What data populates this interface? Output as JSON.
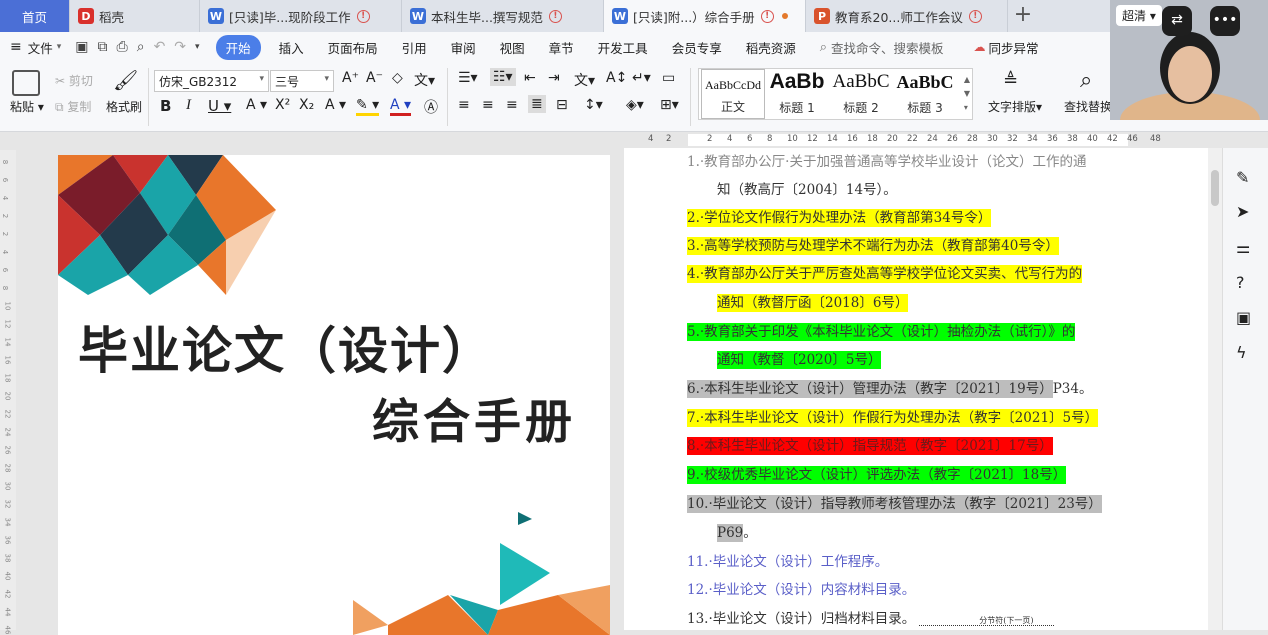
{
  "tabs": [
    {
      "label": "首页",
      "type": "home"
    },
    {
      "label": "稻壳",
      "icon": "docer-icon",
      "icon_color": "#d9302c"
    },
    {
      "label": "[只读]毕...现阶段工作",
      "icon": "word-icon",
      "icon_color": "#3b6fd6",
      "warn": true
    },
    {
      "label": "本科生毕...撰写规范",
      "icon": "word-icon",
      "icon_color": "#3b6fd6",
      "warn": true
    },
    {
      "label": "[只读]附...）综合手册",
      "icon": "word-icon",
      "icon_color": "#3b6fd6",
      "warn": true,
      "active": true,
      "dot": true
    },
    {
      "label": "教育系20...师工作会议",
      "icon": "ppt-icon",
      "icon_color": "#d9532c",
      "warn": true
    }
  ],
  "tab_add": "+",
  "menu": {
    "file": "文件",
    "items": [
      "开始",
      "插入",
      "页面布局",
      "引用",
      "审阅",
      "视图",
      "章节",
      "开发工具",
      "会员专享",
      "稻壳资源"
    ],
    "search_placeholder": "查找命令、搜索模板",
    "sync": "同步异常"
  },
  "ribbon": {
    "paste": "粘贴",
    "cut": "剪切",
    "copy": "复制",
    "format_painter": "格式刷",
    "font_name": "仿宋_GB2312",
    "font_size": "三号",
    "styles": [
      {
        "sample": "AaBbCcDd",
        "label": "正文"
      },
      {
        "sample": "AaBb",
        "label": "标题 1"
      },
      {
        "sample": "AaBbC",
        "label": "标题 2"
      },
      {
        "sample": "AaBbC",
        "label": "标题 3"
      }
    ],
    "text_layout": "文字排版",
    "find_replace": "查找替换"
  },
  "ruler": [
    "4",
    "2",
    "2",
    "4",
    "6",
    "8",
    "10",
    "12",
    "14",
    "16",
    "18",
    "20",
    "22",
    "24",
    "26",
    "28",
    "30",
    "32",
    "34",
    "36",
    "38",
    "40",
    "42",
    "46",
    "48"
  ],
  "vertical_ruler": [
    "8",
    "6",
    "4",
    "2",
    "2",
    "4",
    "6",
    "8",
    "10",
    "12",
    "14",
    "16",
    "18",
    "20",
    "22",
    "24",
    "26",
    "28",
    "30",
    "32",
    "34",
    "36",
    "38",
    "40",
    "42",
    "44",
    "46"
  ],
  "cover": {
    "title_line1": "毕业论文（设计）",
    "title_line2": "综合手册"
  },
  "document_lines": [
    {
      "text": "1.·教育部办公厅·关于加强普通高等学校毕业设计（论文）工作的通",
      "style": "faded"
    },
    {
      "text": "知（教高厅〔2004〕14号）。",
      "indent": true
    },
    {
      "text": "2.·学位论文作假行为处理办法（教育部第34号令）",
      "hl": "yellow"
    },
    {
      "text": "3.·高等学校预防与处理学术不端行为办法（教育部第40号令）",
      "hl": "yellow"
    },
    {
      "text": "4.·教育部办公厅关于严厉查处高等学校学位论文买卖、代写行为的",
      "hl": "yellow"
    },
    {
      "text": "通知（教督厅函〔2018〕6号）",
      "hl": "yellow",
      "indent": true
    },
    {
      "text": "5.·教育部关于印发《本科毕业论文（设计）抽检办法（试行）》的",
      "hl": "green"
    },
    {
      "text": "通知（教督〔2020〕5号）",
      "hl": "green",
      "indent": true
    },
    {
      "text": "6.·本科生毕业论文（设计）管理办法（教字〔2021〕19号）",
      "hl": "gray",
      "suffix": "P34。"
    },
    {
      "text": "7.·本科生毕业论文（设计）作假行为处理办法（教字〔2021〕5号）",
      "hl": "yellow"
    },
    {
      "text": "8.·本科生毕业论文（设计）指导规范（教字〔2021〕17号）",
      "hl": "red"
    },
    {
      "text": "9.·校级优秀毕业论文（设计）评选办法（教字〔2021〕18号）",
      "hl": "green"
    },
    {
      "text": "10.·毕业论文（设计）指导教师考核管理办法（教字〔2021〕23号）",
      "hl": "gray"
    },
    {
      "text": "P69",
      "hl": "gray",
      "indent": true,
      "suffix": "。"
    },
    {
      "text": "11.·毕业论文（设计）工作程序。",
      "style": "blue"
    },
    {
      "text": "12.·毕业论文（设计）内容材料目录。",
      "style": "blue"
    },
    {
      "text": "13.·毕业论文（设计）归档材料目录。",
      "suffix_break": "分节符(下一页)"
    }
  ],
  "webcam": {
    "name": "超清"
  },
  "colors": {
    "accent": "#4b7ee8",
    "home_tab": "#4b6fd6"
  }
}
